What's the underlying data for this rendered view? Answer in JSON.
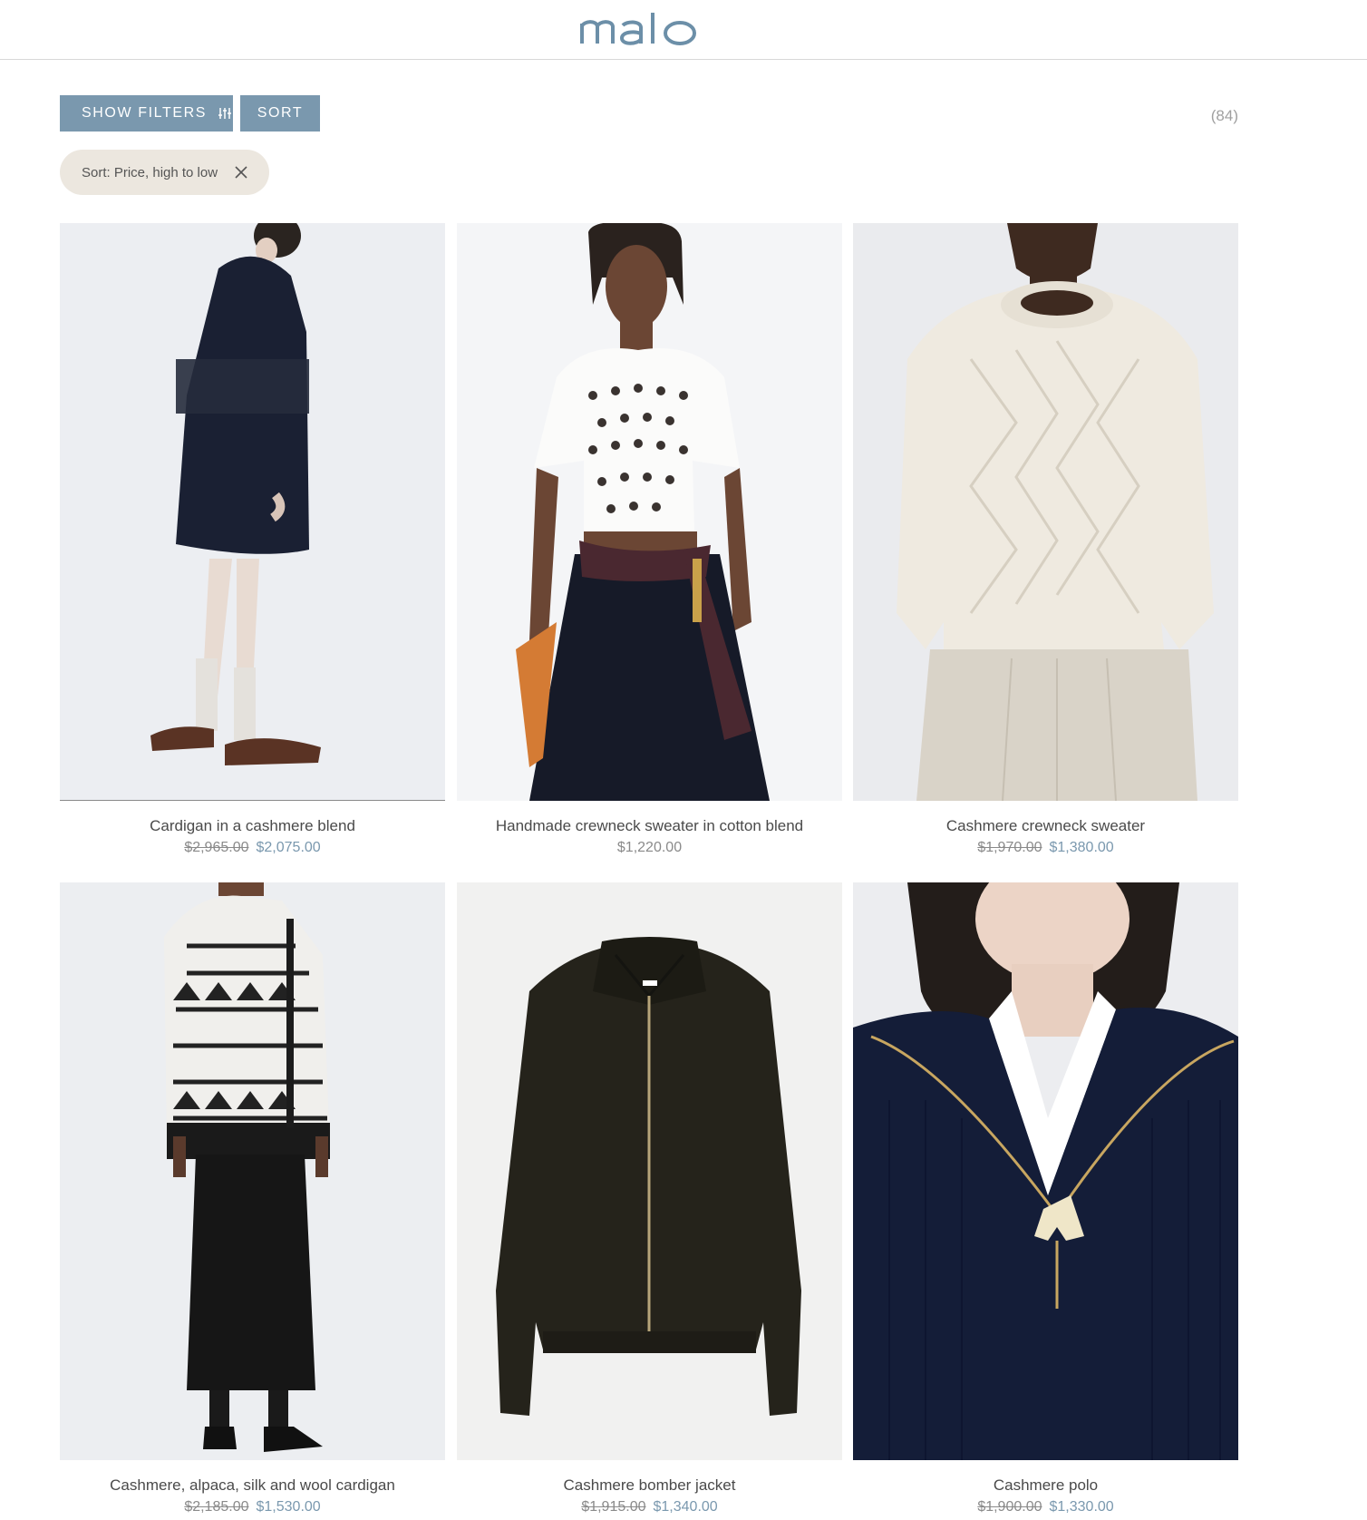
{
  "header": {
    "logo_text": "malo"
  },
  "toolbar": {
    "show_filters_label": "SHOW FILTERS",
    "sort_label": "SORT",
    "result_count": "(84)"
  },
  "active_sort": {
    "label": "Sort: Price, high to low"
  },
  "products": [
    {
      "name": "Cardigan in a cashmere blend",
      "old_price": "$2,965.00",
      "price": "$2,075.00",
      "image": "navy cable-knit long cardigan"
    },
    {
      "name": "Handmade crewneck sweater in cotton blend",
      "old_price": "",
      "price": "$1,220.00",
      "image": "white openwork cropped sweater"
    },
    {
      "name": "Cashmere crewneck sweater",
      "old_price": "$1,970.00",
      "price": "$1,380.00",
      "image": "ivory cable-knit crewneck"
    },
    {
      "name": "Cashmere, alpaca, silk and wool cardigan",
      "old_price": "$2,185.00",
      "price": "$1,530.00",
      "image": "black and white patterned cardigan"
    },
    {
      "name": "Cashmere bomber jacket",
      "old_price": "$1,915.00",
      "price": "$1,340.00",
      "image": "dark olive zip bomber"
    },
    {
      "name": "Cashmere polo",
      "old_price": "$1,900.00",
      "price": "$1,330.00",
      "image": "navy half-zip polo sweater"
    }
  ],
  "colors": {
    "accent": "#7a98ae",
    "chip_bg": "#ece7df",
    "logo": "#6c8fa8"
  }
}
